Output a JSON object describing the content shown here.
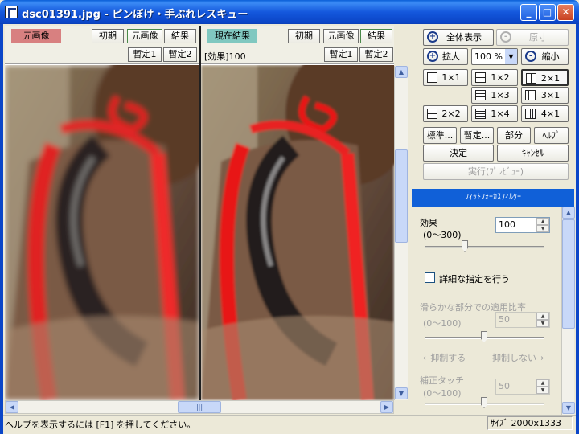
{
  "window": {
    "title": "dsc01391.jpg - ピンぼけ・手ぶれレスキュー",
    "minimize": "_",
    "maximize": "□",
    "close": "✕"
  },
  "left_pane": {
    "tag": "元画像",
    "buttons": {
      "reset": "初期",
      "original": "元画像",
      "result": "結果",
      "temp1": "暫定1",
      "temp2": "暫定2"
    }
  },
  "right_pane": {
    "tag": "現在結果",
    "info": "[効果]100",
    "buttons": {
      "reset": "初期",
      "original": "元画像",
      "result": "結果",
      "temp1": "暫定1",
      "temp2": "暫定2"
    }
  },
  "scroll": {
    "left_arrow": "◀",
    "right_arrow": "▶",
    "up_arrow": "▲",
    "down_arrow": "▼",
    "thumb_grip": "|||"
  },
  "view": {
    "fit_all": "全体表示",
    "original_size": "原寸",
    "zoom_in": "拡大",
    "zoom_level": "100 %",
    "zoom_out": "縮小",
    "layouts": [
      "1×1",
      "1×2",
      "2×1",
      "1×3",
      "3×1",
      "2×2",
      "1×4",
      "4×1"
    ]
  },
  "actions": {
    "standard": "標準...",
    "temp": "暫定...",
    "part": "部分",
    "help": "ﾍﾙﾌﾟ",
    "decide": "決定",
    "cancel": "ｷｬﾝｾﾙ",
    "execute": "実行(ﾌﾟﾚﾋﾞｭｰ)"
  },
  "filter": {
    "name": "ﾌｨｯﾄﾌｫｰｶｽﾌｨﾙﾀｰ",
    "effect_label": "効果",
    "effect_range": "(0〜300)",
    "effect_value": "100",
    "effect_level": 100,
    "detail_checkbox": "詳細な指定を行う",
    "smooth_label": "滑らかな部分での適用比率",
    "smooth_range": "(0〜100)",
    "smooth_value": "50",
    "smooth_level": 50,
    "suppress": "←抑制する",
    "no_suppress": "抑制しない→",
    "touch_label": "補正タッチ",
    "touch_range": "(0〜100)",
    "touch_value": "50",
    "touch_level": 50
  },
  "status": {
    "help_text": "ヘルプを表示するには [F1] を押してください。",
    "size": "ｻｲｽﾞ 2000x1333"
  }
}
